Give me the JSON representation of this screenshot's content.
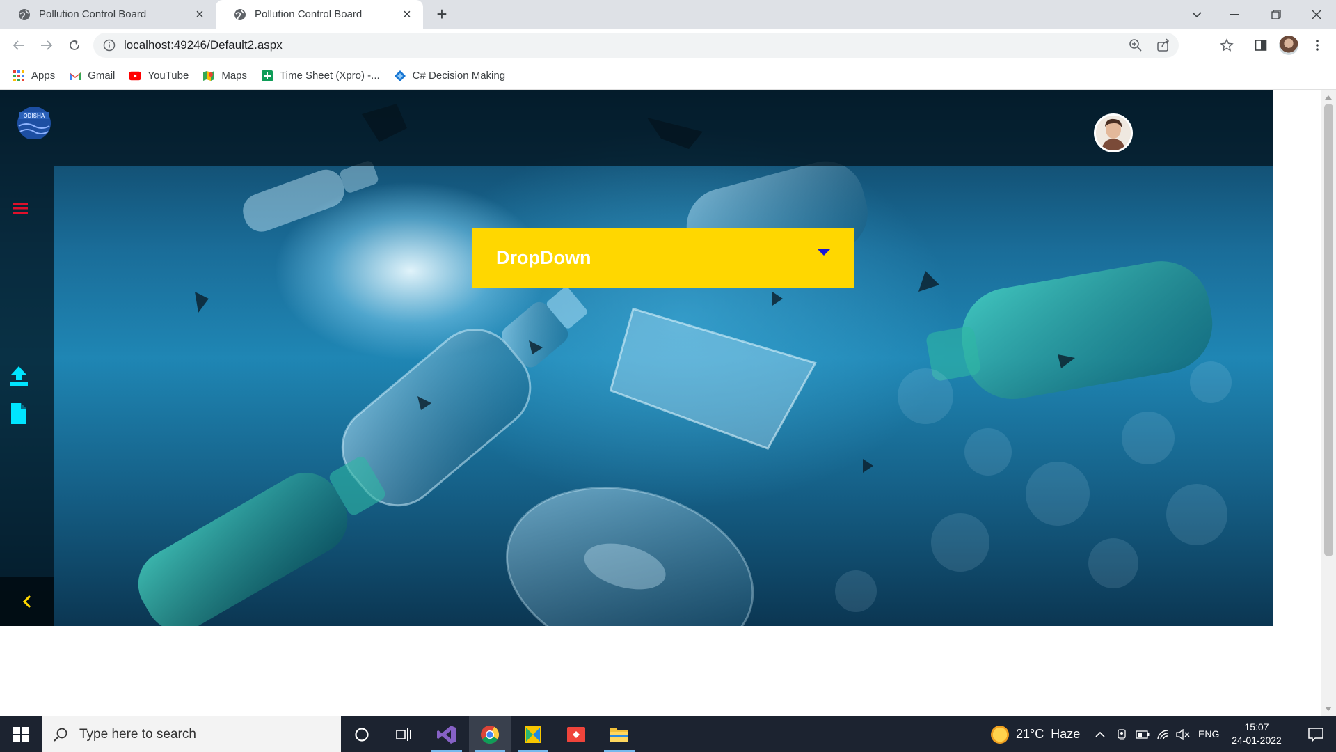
{
  "browser": {
    "tabs": [
      {
        "title": "Pollution Control Board",
        "active": false
      },
      {
        "title": "Pollution Control Board",
        "active": true
      }
    ],
    "url": "localhost:49246/Default2.aspx",
    "bookmarks": [
      {
        "label": "Apps",
        "icon": "apps-grid-icon"
      },
      {
        "label": "Gmail",
        "icon": "gmail-icon"
      },
      {
        "label": "YouTube",
        "icon": "youtube-icon"
      },
      {
        "label": "Maps",
        "icon": "maps-icon"
      },
      {
        "label": "Time Sheet (Xpro) -...",
        "icon": "sheets-icon"
      },
      {
        "label": "C# Decision Making",
        "icon": "diamond-icon"
      }
    ]
  },
  "page": {
    "logo_icon": "odisha-logo",
    "dropdown_label": "DropDown",
    "sidebar_icons": [
      "menu-icon",
      "upload-icon",
      "file-icon",
      "chevron-left-icon"
    ],
    "colors": {
      "dropdown_bg": "#ffd700",
      "dropdown_caret": "#1a17d6",
      "menu_icon": "#e0102b",
      "sidebar_icons": "#00e5ff",
      "collapse_chevron": "#ffd700"
    }
  },
  "taskbar": {
    "search_placeholder": "Type here to search",
    "weather": "21°C  Haze",
    "language": "ENG",
    "time": "15:07",
    "date": "24-01-2022"
  }
}
